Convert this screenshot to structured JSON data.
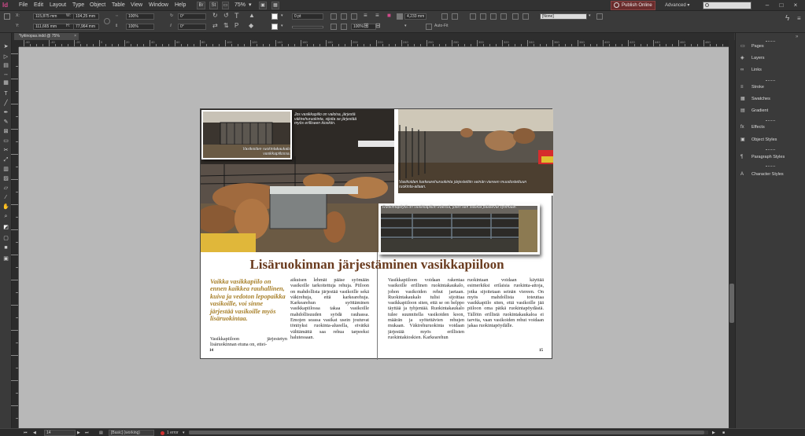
{
  "app": {
    "logo": "Id"
  },
  "menu": [
    "File",
    "Edit",
    "Layout",
    "Type",
    "Object",
    "Table",
    "View",
    "Window",
    "Help"
  ],
  "menubar": {
    "br_label": "Br",
    "st_label": "St",
    "zoom": "75%",
    "publish_online": "Publish Online",
    "workspace": "Advanced",
    "search_placeholder": ""
  },
  "control": {
    "x": "115,875 mm",
    "y": "111,665 mm",
    "w": "104,25 mm",
    "h": "77,964 mm",
    "scale_x": "100%",
    "scale_y": "100%",
    "rotate": "0°",
    "shear": "0°",
    "stroke_weight": "0 pt",
    "offset": "4,233 mm",
    "opacity": "100%",
    "auto_fit": "Auto-Fit",
    "style": "[None]"
  },
  "tab": {
    "label": "*tyitinopas.indd @ 75%"
  },
  "ruler": {
    "labels": [
      "-60",
      "-40",
      "-20",
      "0",
      "20",
      "40",
      "60",
      "80",
      "100",
      "120",
      "140",
      "160",
      "180",
      "200",
      "220",
      "240",
      "260",
      "280",
      "300",
      "320",
      "340",
      "360",
      "380",
      "400",
      "420",
      "440",
      "460",
      "480"
    ]
  },
  "document": {
    "title": "Lisäruokinnan järjestäminen vasikkapiiloon",
    "pullquote": "Vaikka vasikkapiilo on ennen kaikkea rauhallinen, kuiva ja vedoton lepopaikka vasikoille, voi sinne järjestää vasikoille myös lisäruokintaa.",
    "col1": "Vasikkapiiloon järjestetyn lisäruokinnan etuna on, ettei-",
    "col2": "aikuisen lehmät pääse syömään vasikoille tarkoitettuja rehuja. Piiloon on mahdollista järjestää vasikoille sekä väkirehuja, että karkearehuja. Karkearehun syöttäminen vasikkapiilossa takaa vasikoille mahdollisuuden syödä rauhassa. Emojen seassa vasikat usein joutuvat tönityksi ruokinta-alueella, eivätkä välttämättä saa rehua tarpeeksi halutessaan.",
    "col3": "Vasikkapiiloon voidaan rakentaa vasikoille erillinen ruokintakaukalo, johon vasikoiden rehut jaetaan. Ruokintakaukalo tulisi sijoittaa vasikkapiiloon siten, että se on helppo täyttää ja tyhjentää. Ruokintakaukalo tulee suunnitella vasikoiden koon, määrän ja syötettävien rehujen mukaan. Väkirehuruokinta voidaan järjestää myös erillisten ruokintakioskien. Karkearehun",
    "col4": "ruokintaan voidaan käyttää esimerkiksi erilaisia ruokinta-aitoja, jotka sijoitetaan seinän viereen. On myös mahdollista toteuttaa vasikkapiilo siten, että vasikoille jää piiloon oma pätkä ruokintapöydästä. Tällöin erillistä ruokintakaukaloa ei tarvita, vaan vasikoiden rehut voidaan jakaa ruokintapöydälle.",
    "folio_left": "14",
    "folio_right": "15",
    "captions": {
      "c1": "Vasikoiden ruokintakaukalo vasikkapiilossa.",
      "c2": "Jos vasikkapiilo on valoisa, järjestä väkirehuruokinta, sijoita se järjestää myös erilliseen kioskiin.",
      "c3": "Vasikoiden karkearehuruokinta järjestettiin seinän viereen muodostettuun ruokinta-aitaan.",
      "c4": "Ruokintapöytä on vasikkapiilon edessä, joten sen vasikat pääsevät syömään."
    }
  },
  "panels": [
    {
      "icon": "pages-icon",
      "glyph": "▭",
      "label": "Pages"
    },
    {
      "icon": "layers-icon",
      "glyph": "◈",
      "label": "Layers"
    },
    {
      "icon": "links-icon",
      "glyph": "∞",
      "label": "Links"
    },
    {
      "icon": "stroke-icon",
      "glyph": "≡",
      "label": "Stroke"
    },
    {
      "icon": "swatches-icon",
      "glyph": "▦",
      "label": "Swatches"
    },
    {
      "icon": "gradient-icon",
      "glyph": "▤",
      "label": "Gradient"
    },
    {
      "icon": "effects-icon",
      "glyph": "fx",
      "label": "Effects"
    },
    {
      "icon": "object-styles-icon",
      "glyph": "▣",
      "label": "Object Styles"
    },
    {
      "icon": "paragraph-styles-icon",
      "glyph": "¶",
      "label": "Paragraph Styles"
    },
    {
      "icon": "character-styles-icon",
      "glyph": "A",
      "label": "Character Styles"
    }
  ],
  "status": {
    "page": "14",
    "style": "[Basic] (working)",
    "errors": "1 error",
    "error_color": "#d03030"
  }
}
